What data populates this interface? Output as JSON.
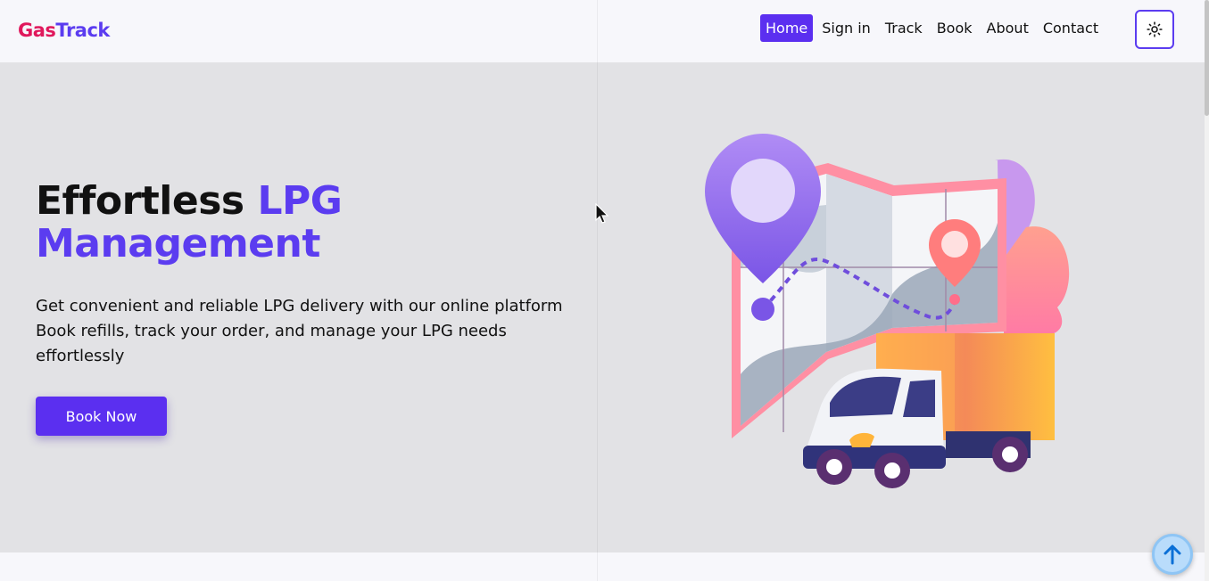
{
  "brand": {
    "part1": "Gas",
    "part2": "Track"
  },
  "nav": {
    "items": [
      "Home",
      "Sign in",
      "Track",
      "Book",
      "About",
      "Contact"
    ],
    "active": "Home"
  },
  "hero": {
    "title_plain": "Effortless ",
    "title_accent_line1": "LPG",
    "title_accent_line2": "Management",
    "desc_line1": "Get convenient and reliable LPG delivery with our online platform",
    "desc_line2": "Book refills, track your order, and manage your LPG needs",
    "desc_line3": "effortlessly",
    "cta": "Book Now"
  },
  "icons": {
    "theme_toggle": "sun-icon",
    "scroll_top": "arrow-up-icon",
    "cursor": "mouse-pointer-icon"
  },
  "colors": {
    "accent": "#5b3cf0",
    "brand_red": "#e0185c",
    "hero_bg": "#e2e2e5"
  }
}
